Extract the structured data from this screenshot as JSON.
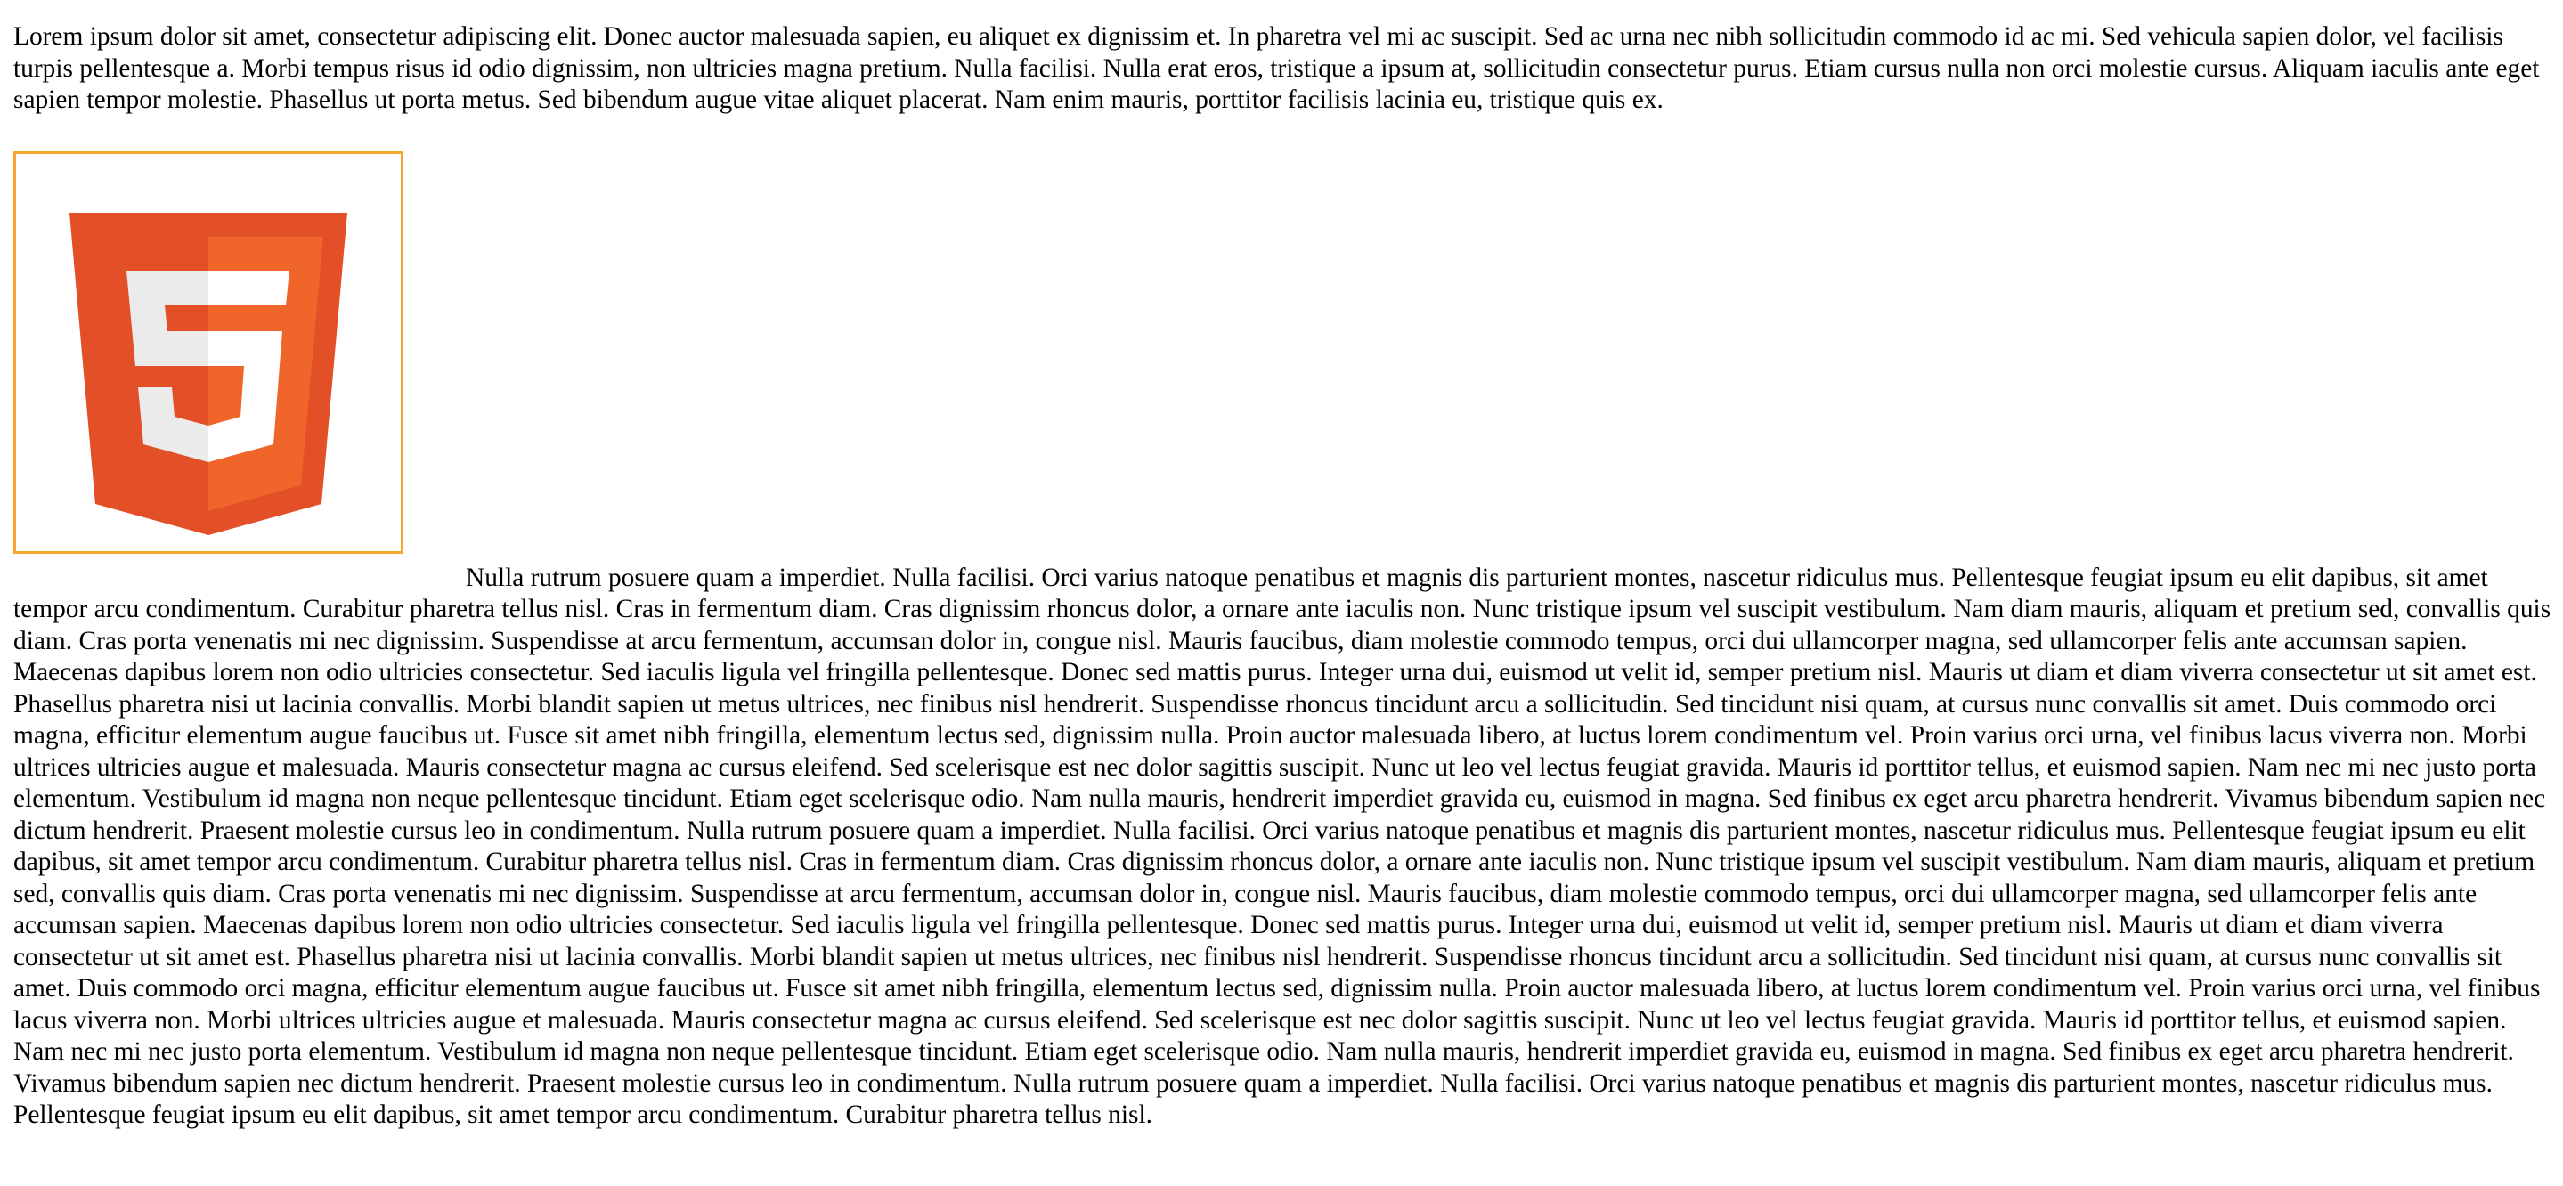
{
  "paragraphs": {
    "intro": "Lorem ipsum dolor sit amet, consectetur adipiscing elit. Donec auctor malesuada sapien, eu aliquet ex dignissim et. In pharetra vel mi ac suscipit. Sed ac urna nec nibh sollicitudin commodo id ac mi. Sed vehicula sapien dolor, vel facilisis turpis pellentesque a. Morbi tempus risus id odio dignissim, non ultricies magna pretium. Nulla facilisi. Nulla erat eros, tristique a ipsum at, sollicitudin consectetur purus. Etiam cursus nulla non orci molestie cursus. Aliquam iaculis ante eget sapien tempor molestie. Phasellus ut porta metus. Sed bibendum augue vitae aliquet placerat. Nam enim mauris, porttitor facilisis lacinia eu, tristique quis ex.",
    "body": "Nulla rutrum posuere quam a imperdiet. Nulla facilisi. Orci varius natoque penatibus et magnis dis parturient montes, nascetur ridiculus mus. Pellentesque feugiat ipsum eu elit dapibus, sit amet tempor arcu condimentum. Curabitur pharetra tellus nisl. Cras in fermentum diam. Cras dignissim rhoncus dolor, a ornare ante iaculis non. Nunc tristique ipsum vel suscipit vestibulum. Nam diam mauris, aliquam et pretium sed, convallis quis diam. Cras porta venenatis mi nec dignissim. Suspendisse at arcu fermentum, accumsan dolor in, congue nisl. Mauris faucibus, diam molestie commodo tempus, orci dui ullamcorper magna, sed ullamcorper felis ante accumsan sapien. Maecenas dapibus lorem non odio ultricies consectetur. Sed iaculis ligula vel fringilla pellentesque. Donec sed mattis purus. Integer urna dui, euismod ut velit id, semper pretium nisl. Mauris ut diam et diam viverra consectetur ut sit amet est. Phasellus pharetra nisi ut lacinia convallis. Morbi blandit sapien ut metus ultrices, nec finibus nisl hendrerit. Suspendisse rhoncus tincidunt arcu a sollicitudin. Sed tincidunt nisi quam, at cursus nunc convallis sit amet. Duis commodo orci magna, efficitur elementum augue faucibus ut. Fusce sit amet nibh fringilla, elementum lectus sed, dignissim nulla. Proin auctor malesuada libero, at luctus lorem condimentum vel. Proin varius orci urna, vel finibus lacus viverra non. Morbi ultrices ultricies augue et malesuada. Mauris consectetur magna ac cursus eleifend. Sed scelerisque est nec dolor sagittis suscipit. Nunc ut leo vel lectus feugiat gravida. Mauris id porttitor tellus, et euismod sapien. Nam nec mi nec justo porta elementum. Vestibulum id magna non neque pellentesque tincidunt. Etiam eget scelerisque odio. Nam nulla mauris, hendrerit imperdiet gravida eu, euismod in magna. Sed finibus ex eget arcu pharetra hendrerit. Vivamus bibendum sapien nec dictum hendrerit. Praesent molestie cursus leo in condimentum. Nulla rutrum posuere quam a imperdiet. Nulla facilisi. Orci varius natoque penatibus et magnis dis parturient montes, nascetur ridiculus mus. Pellentesque feugiat ipsum eu elit dapibus, sit amet tempor arcu condimentum. Curabitur pharetra tellus nisl. Cras in fermentum diam. Cras dignissim rhoncus dolor, a ornare ante iaculis non. Nunc tristique ipsum vel suscipit vestibulum. Nam diam mauris, aliquam et pretium sed, convallis quis diam. Cras porta venenatis mi nec dignissim. Suspendisse at arcu fermentum, accumsan dolor in, congue nisl. Mauris faucibus, diam molestie commodo tempus, orci dui ullamcorper magna, sed ullamcorper felis ante accumsan sapien. Maecenas dapibus lorem non odio ultricies consectetur. Sed iaculis ligula vel fringilla pellentesque. Donec sed mattis purus. Integer urna dui, euismod ut velit id, semper pretium nisl. Mauris ut diam et diam viverra consectetur ut sit amet est. Phasellus pharetra nisi ut lacinia convallis. Morbi blandit sapien ut metus ultrices, nec finibus nisl hendrerit. Suspendisse rhoncus tincidunt arcu a sollicitudin. Sed tincidunt nisi quam, at cursus nunc convallis sit amet. Duis commodo orci magna, efficitur elementum augue faucibus ut. Fusce sit amet nibh fringilla, elementum lectus sed, dignissim nulla. Proin auctor malesuada libero, at luctus lorem condimentum vel. Proin varius orci urna, vel finibus lacus viverra non. Morbi ultrices ultricies augue et malesuada. Mauris consectetur magna ac cursus eleifend. Sed scelerisque est nec dolor sagittis suscipit. Nunc ut leo vel lectus feugiat gravida. Mauris id porttitor tellus, et euismod sapien. Nam nec mi nec justo porta elementum. Vestibulum id magna non neque pellentesque tincidunt. Etiam eget scelerisque odio. Nam nulla mauris, hendrerit imperdiet gravida eu, euismod in magna. Sed finibus ex eget arcu pharetra hendrerit. Vivamus bibendum sapien nec dictum hendrerit. Praesent molestie cursus leo in condimentum. Nulla rutrum posuere quam a imperdiet. Nulla facilisi. Orci varius natoque penatibus et magnis dis parturient montes, nascetur ridiculus mus. Pellentesque feugiat ipsum eu elit dapibus, sit amet tempor arcu condimentum. Curabitur pharetra tellus nisl."
  },
  "image": {
    "icon": "html5-logo-icon",
    "border_color": "#f4a732",
    "colors": {
      "shield_dark": "#e34f26",
      "shield_light": "#ef652a",
      "glyph_white": "#ebebeb",
      "glyph_bright": "#ffffff"
    }
  }
}
